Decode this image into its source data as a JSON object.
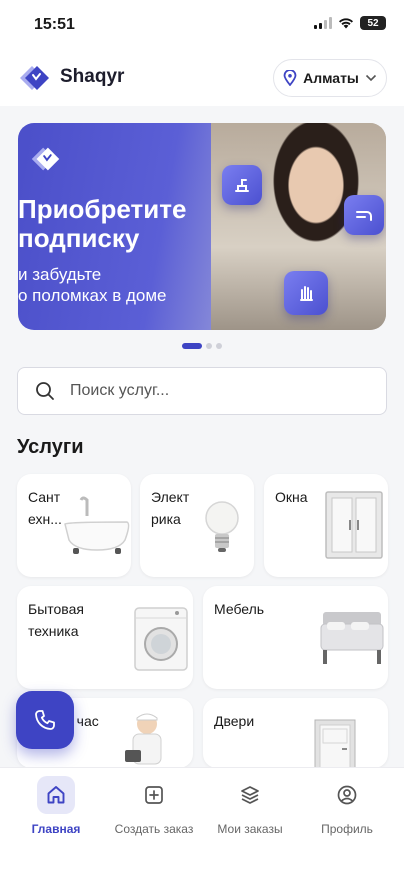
{
  "status": {
    "time": "15:51",
    "battery": "52"
  },
  "header": {
    "app_name": "Shaqyr",
    "city": "Алматы"
  },
  "banner": {
    "title_line1": "Приобретите",
    "title_line2": "подписку",
    "sub_line1": "и забудьте",
    "sub_line2": "о поломках в доме"
  },
  "carousel": {
    "total": 3,
    "active": 1
  },
  "search": {
    "placeholder": "Поиск услуг..."
  },
  "services": {
    "title": "Услуги",
    "items": [
      {
        "label_l1": "Сант",
        "label_l2": "ехн...",
        "icon": "bathtub-image"
      },
      {
        "label_l1": "Элект",
        "label_l2": "рика",
        "icon": "lightbulb-image"
      },
      {
        "label_l1": "Окна",
        "label_l2": "",
        "icon": "window-image"
      },
      {
        "label_l1": "Бытовая",
        "label_l2": "техника",
        "icon": "washing-machine-image"
      },
      {
        "label_l1": "Мебель",
        "label_l2": "",
        "icon": "bed-image"
      },
      {
        "label_l1": "а час",
        "label_l2": "",
        "icon": "handyman-image"
      },
      {
        "label_l1": "Двери",
        "label_l2": "",
        "icon": "door-image"
      }
    ]
  },
  "tabs": [
    {
      "label": "Главная",
      "icon": "home-icon",
      "active": true
    },
    {
      "label": "Создать заказ",
      "icon": "plus-square-icon",
      "active": false
    },
    {
      "label": "Мои заказы",
      "icon": "layers-icon",
      "active": false
    },
    {
      "label": "Профиль",
      "icon": "user-circle-icon",
      "active": false
    }
  ],
  "colors": {
    "accent": "#3e44c4",
    "background": "#f5f6f8"
  }
}
